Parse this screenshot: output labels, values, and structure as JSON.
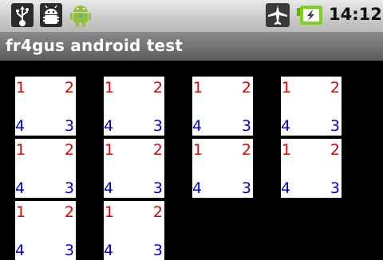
{
  "status_bar": {
    "time": "14:12",
    "icons": [
      "usb-icon",
      "debug-icon",
      "app-icon",
      "airplane-signal-icon",
      "battery-charging-icon"
    ]
  },
  "title_bar": {
    "title": "fr4gus android test"
  },
  "tiles": [
    {
      "tl": "1",
      "tr": "2",
      "bl": "4",
      "br": "3"
    },
    {
      "tl": "1",
      "tr": "2",
      "bl": "4",
      "br": "3"
    },
    {
      "tl": "1",
      "tr": "2",
      "bl": "4",
      "br": "3"
    },
    {
      "tl": "1",
      "tr": "2",
      "bl": "4",
      "br": "3"
    },
    {
      "tl": "1",
      "tr": "2",
      "bl": "4",
      "br": "3"
    },
    {
      "tl": "1",
      "tr": "2",
      "bl": "4",
      "br": "3"
    },
    {
      "tl": "1",
      "tr": "2",
      "bl": "4",
      "br": "3"
    },
    {
      "tl": "1",
      "tr": "2",
      "bl": "4",
      "br": "3"
    },
    {
      "tl": "1",
      "tr": "2",
      "bl": "4",
      "br": "3"
    },
    {
      "tl": "1",
      "tr": "2",
      "bl": "4",
      "br": "3"
    }
  ],
  "colors": {
    "top_numbers": "#e00000",
    "bottom_numbers": "#0000e0",
    "battery": "#7ad317"
  }
}
